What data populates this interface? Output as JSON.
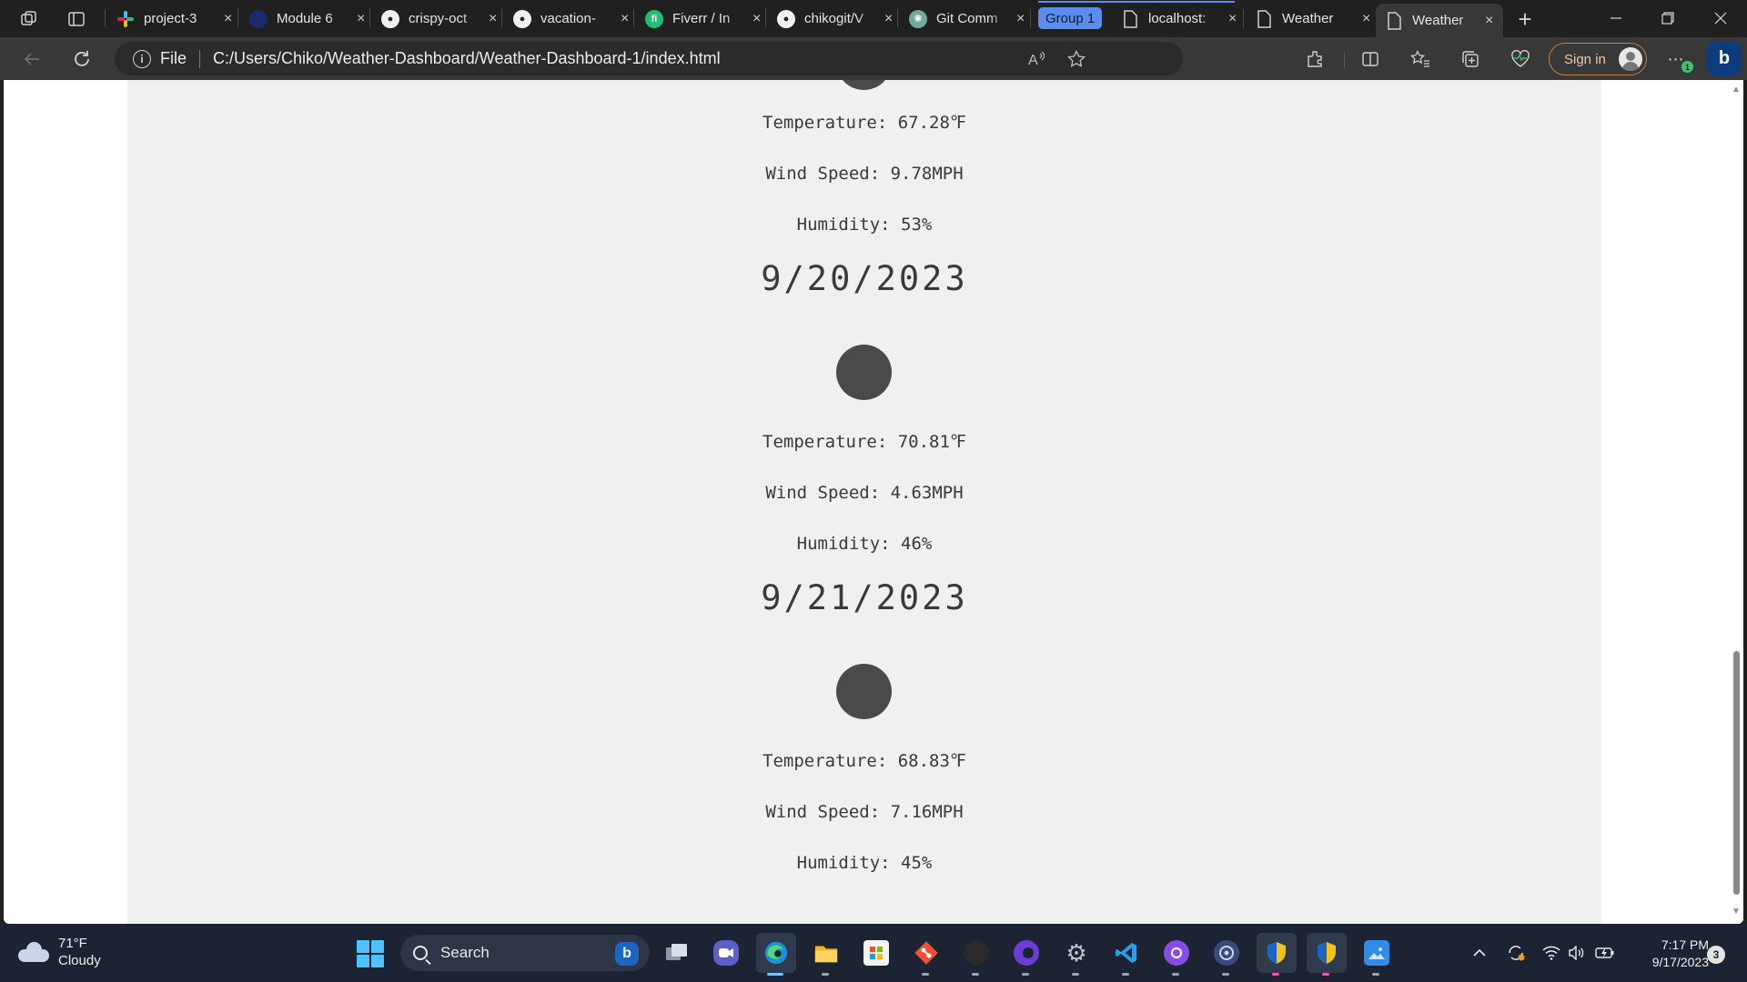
{
  "browser": {
    "tabs": [
      {
        "title": "project-3",
        "favicon": "slack-icon"
      },
      {
        "title": "Module 6",
        "favicon": "module-icon"
      },
      {
        "title": "crispy-oct",
        "favicon": "github-icon"
      },
      {
        "title": "vacation-",
        "favicon": "github-icon"
      },
      {
        "title": "Fiverr / In",
        "favicon": "fiverr-icon"
      },
      {
        "title": "chikogit/V",
        "favicon": "github-icon"
      },
      {
        "title": "Git Comm",
        "favicon": "chatgpt-icon"
      },
      {
        "title": "localhost:",
        "favicon": "page-icon"
      },
      {
        "title": "Weather",
        "favicon": "page-icon"
      },
      {
        "title": "Weather",
        "favicon": "page-icon"
      }
    ],
    "tab_group_label": "Group 1",
    "close_glyph": "×",
    "new_tab_glyph": "+",
    "address": {
      "protocol_label": "File",
      "url": "C:/Users/Chiko/Weather-Dashboard/Weather-Dashboard-1/index.html"
    },
    "sign_in_label": "Sign in",
    "accent_color": "#5b8def"
  },
  "forecast": [
    {
      "temperature": "Temperature: 67.28℉",
      "wind": "Wind Speed: 9.78MPH",
      "humidity": "Humidity: 53%"
    },
    {
      "date": "9/20/2023",
      "temperature": "Temperature: 70.81℉",
      "wind": "Wind Speed: 4.63MPH",
      "humidity": "Humidity: 46%"
    },
    {
      "date": "9/21/2023",
      "temperature": "Temperature: 68.83℉",
      "wind": "Wind Speed: 7.16MPH",
      "humidity": "Humidity: 45%"
    }
  ],
  "taskbar": {
    "weather": {
      "temp": "71°F",
      "condition": "Cloudy"
    },
    "search_label": "Search",
    "clock": {
      "time": "7:17 PM",
      "date": "9/17/2023"
    },
    "notification_count": "3",
    "update_badge": "1"
  }
}
